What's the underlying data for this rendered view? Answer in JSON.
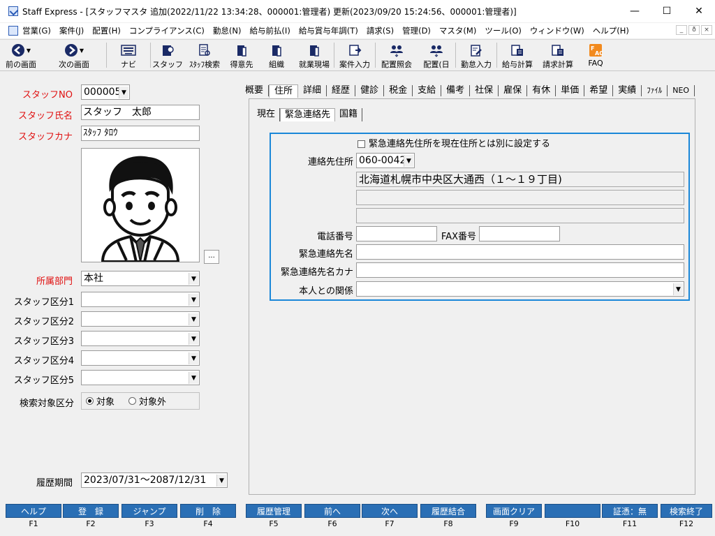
{
  "window": {
    "title": "Staff Express - [スタッフマスタ 追加(2022/11/22 13:34:28、000001:管理者) 更新(2023/09/20 15:24:56、000001:管理者)]",
    "controls": {
      "minimize": "—",
      "maximize": "☐",
      "close": "✕"
    }
  },
  "menu": [
    "営業(G)",
    "案件(J)",
    "配置(H)",
    "コンプライアンス(C)",
    "勤怠(N)",
    "給与前払(I)",
    "給与賞与年調(T)",
    "請求(S)",
    "管理(D)",
    "マスタ(M)",
    "ツール(O)",
    "ウィンドウ(W)",
    "ヘルプ(H)"
  ],
  "mdi_controls": [
    "_",
    "ð",
    "×"
  ],
  "toolbar": [
    {
      "label": "前の画面",
      "icon": "arrow-left-icon"
    },
    {
      "label": "次の画面",
      "icon": "arrow-right-icon"
    },
    {
      "label": "ナビ",
      "icon": "keyboard-icon"
    },
    {
      "label": "スタッフ",
      "icon": "staff-icon"
    },
    {
      "label": "ｽﾀｯﾌ検索",
      "icon": "staff-search-icon"
    },
    {
      "label": "得意先",
      "icon": "client-icon"
    },
    {
      "label": "組織",
      "icon": "organization-icon"
    },
    {
      "label": "就業現場",
      "icon": "worksite-icon"
    },
    {
      "label": "案件入力",
      "icon": "job-entry-icon"
    },
    {
      "label": "配置照会",
      "icon": "placement-inquiry-icon"
    },
    {
      "label": "配置(日",
      "icon": "placement-daily-icon"
    },
    {
      "label": "勤怠入力",
      "icon": "attendance-entry-icon"
    },
    {
      "label": "給与計算",
      "icon": "payroll-calc-icon"
    },
    {
      "label": "請求計算",
      "icon": "billing-calc-icon"
    },
    {
      "label": "FAQ",
      "icon": "faq-icon"
    }
  ],
  "left": {
    "staff_no_label": "スタッフNO",
    "staff_no": "000005",
    "staff_name_label": "スタッフ氏名",
    "staff_name": "スタッフ　太郎",
    "staff_kana_label": "スタッフカナ",
    "staff_kana": "ｽﾀｯﾌ ﾀﾛｳ",
    "photo_button": "...",
    "dept_label": "所属部門",
    "dept": "本社",
    "category1_label": "スタッフ区分1",
    "category2_label": "スタッフ区分2",
    "category3_label": "スタッフ区分3",
    "category4_label": "スタッフ区分4",
    "category5_label": "スタッフ区分5",
    "search_label": "検索対象区分",
    "search_opt_on": "対象",
    "search_opt_off": "対象外",
    "history_label": "履歴期間",
    "history_value": "2023/07/31〜2087/12/31"
  },
  "tabs": [
    "概要",
    "住所",
    "詳細",
    "経歴",
    "健診",
    "税金",
    "支給",
    "備考",
    "社保",
    "雇保",
    "有休",
    "単価",
    "希望",
    "実績",
    "ﾌｧｲﾙ",
    "NEO"
  ],
  "active_tab": "住所",
  "subtabs": [
    "現在",
    "緊急連絡先",
    "国籍"
  ],
  "emergency": {
    "checkbox_label": "緊急連絡先住所を現在住所とは別に設定する",
    "address_label": "連絡先住所",
    "postal": "060-0042",
    "address1": "北海道札幌市中央区大通西（１〜１９丁目)",
    "tel_label": "電話番号",
    "fax_label": "FAX番号",
    "contact_name_label": "緊急連絡先名",
    "contact_kana_label": "緊急連絡先名カナ",
    "relation_label": "本人との関係"
  },
  "fkeys": [
    {
      "label": "ヘルプ",
      "key": "F1"
    },
    {
      "label": "登　録",
      "key": "F2"
    },
    {
      "label": "ジャンプ",
      "key": "F3"
    },
    {
      "label": "削　除",
      "key": "F4"
    },
    {
      "label": "履歴管理",
      "key": "F5"
    },
    {
      "label": "前へ",
      "key": "F6"
    },
    {
      "label": "次へ",
      "key": "F7"
    },
    {
      "label": "履歴結合",
      "key": "F8"
    },
    {
      "label": "画面クリア",
      "key": "F9"
    },
    {
      "label": "",
      "key": "F10"
    },
    {
      "label": "証憑：無",
      "key": "F11"
    },
    {
      "label": "検索終了",
      "key": "F12"
    }
  ]
}
